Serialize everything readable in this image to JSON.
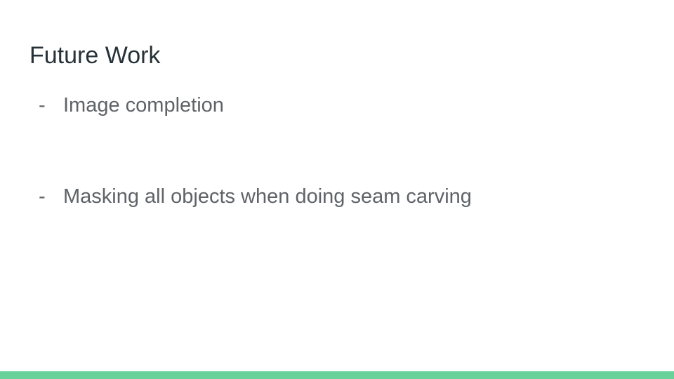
{
  "slide": {
    "title": "Future Work",
    "bullets": [
      {
        "marker": "-",
        "text": "Image completion"
      },
      {
        "marker": "-",
        "text": "Masking all objects when doing seam carving"
      }
    ]
  },
  "colors": {
    "background": "#ffffff",
    "title_text": "#263238",
    "body_text": "#5f6368",
    "footer_bar": "#69d29a"
  }
}
